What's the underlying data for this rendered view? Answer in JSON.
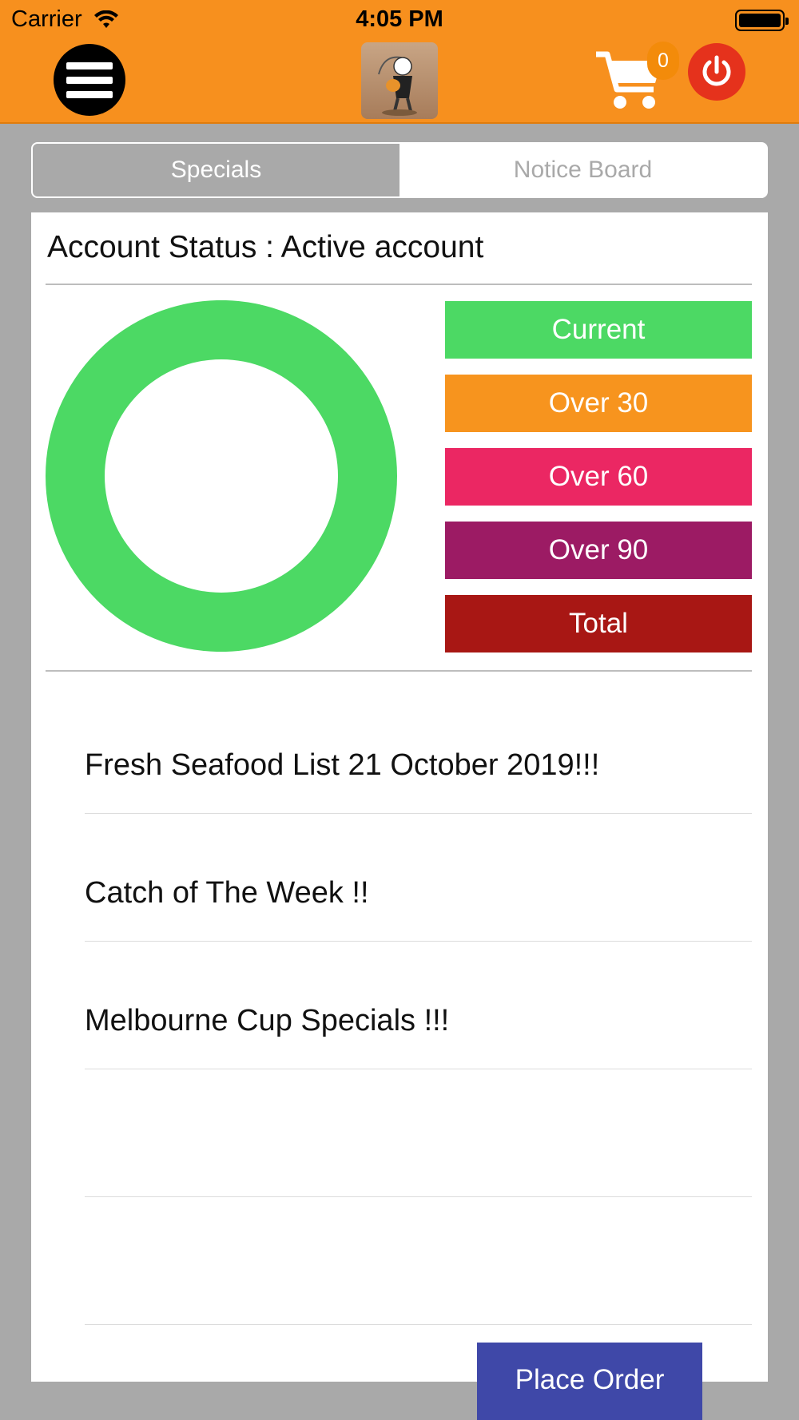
{
  "status_bar": {
    "carrier": "Carrier",
    "time": "4:05 PM"
  },
  "header": {
    "menu_icon": "hamburger-icon",
    "logo": "app-logo",
    "cart_icon": "cart-icon",
    "cart_count": "0",
    "power_icon": "power-icon",
    "accent_color": "#f7901e"
  },
  "tabs": [
    {
      "label": "Specials",
      "active": true
    },
    {
      "label": "Notice Board",
      "active": false
    }
  ],
  "account": {
    "status_text": "Account Status : Active account"
  },
  "chart_data": {
    "type": "pie",
    "categories": [
      "Current",
      "Over 30",
      "Over 60",
      "Over 90"
    ],
    "values": [
      1,
      0,
      0,
      0
    ],
    "legend": [
      "Current",
      "Over 30",
      "Over 60",
      "Over 90",
      "Total"
    ],
    "colors": [
      "#4cd964",
      "#f7941e",
      "#eb2763",
      "#9c1b64",
      "#a81714"
    ]
  },
  "notices": [
    "Fresh Seafood List 21 October 2019!!!",
    "Catch of The Week !!",
    "Melbourne Cup Specials !!!",
    "",
    ""
  ],
  "place_order_label": "Place Order"
}
